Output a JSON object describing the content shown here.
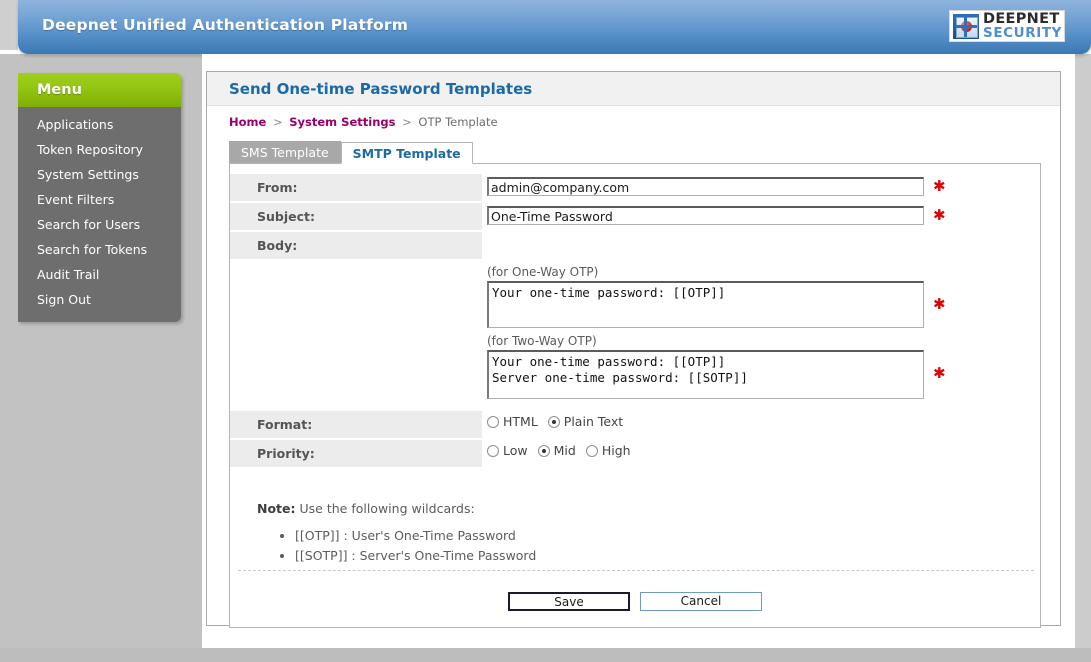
{
  "banner": {
    "title": "Deepnet Unified Authentication Platform",
    "logo_primary": "DEEPNET",
    "logo_secondary": "SECURITY",
    "logo_icon": "deepnet-shield-icon"
  },
  "sidebar": {
    "header": "Menu",
    "items": [
      {
        "label": "Applications"
      },
      {
        "label": "Token Repository"
      },
      {
        "label": "System Settings"
      },
      {
        "label": "Event Filters"
      },
      {
        "label": "Search for Users"
      },
      {
        "label": "Search for Tokens"
      },
      {
        "label": "Audit Trail"
      },
      {
        "label": "Sign Out"
      }
    ]
  },
  "main": {
    "page_title": "Send One-time Password Templates",
    "breadcrumb": {
      "home": "Home",
      "sep1": ">",
      "section": "System Settings",
      "sep2": ">",
      "current": "OTP Template"
    },
    "tabs": [
      {
        "label": "SMS Template",
        "active": false
      },
      {
        "label": "SMTP Template",
        "active": true
      }
    ],
    "form": {
      "from": {
        "label": "From:",
        "value": "admin@company.com",
        "placeholder": "",
        "required_marker": "✱"
      },
      "subject": {
        "label": "Subject:",
        "value": "One-Time Password",
        "placeholder": "",
        "required_marker": "✱"
      },
      "body": {
        "label": "Body:",
        "one_way_caption": "(for One-Way OTP)",
        "one_way_value": "Your one-time password: [[OTP]]",
        "one_way_required_marker": "✱",
        "two_way_caption": "(for Two-Way OTP)",
        "two_way_value": "Your one-time password: [[OTP]]\nServer one-time password: [[SOTP]]",
        "two_way_required_marker": "✱"
      },
      "format": {
        "label": "Format:",
        "options": [
          {
            "label": "HTML",
            "selected": false
          },
          {
            "label": "Plain Text",
            "selected": true
          }
        ]
      },
      "priority": {
        "label": "Priority:",
        "options": [
          {
            "label": "Low",
            "selected": false
          },
          {
            "label": "Mid",
            "selected": true
          },
          {
            "label": "High",
            "selected": false
          }
        ]
      }
    },
    "note": {
      "title": "Note:",
      "text": "Use the following wildcards:",
      "items": [
        "[[OTP]] : User's One-Time Password",
        "[[SOTP]] : Server's One-Time Password"
      ]
    },
    "buttons": {
      "save": "Save",
      "cancel": "Cancel"
    }
  },
  "colors": {
    "banner_top": "#8fb4dd",
    "banner_bottom": "#3b78b4",
    "menu_green": "#93c513",
    "menu_gray": "#6e6e6e",
    "title_blue": "#1b6aa5",
    "breadcrumb_link": "#99006b",
    "required_red": "#e00000"
  }
}
